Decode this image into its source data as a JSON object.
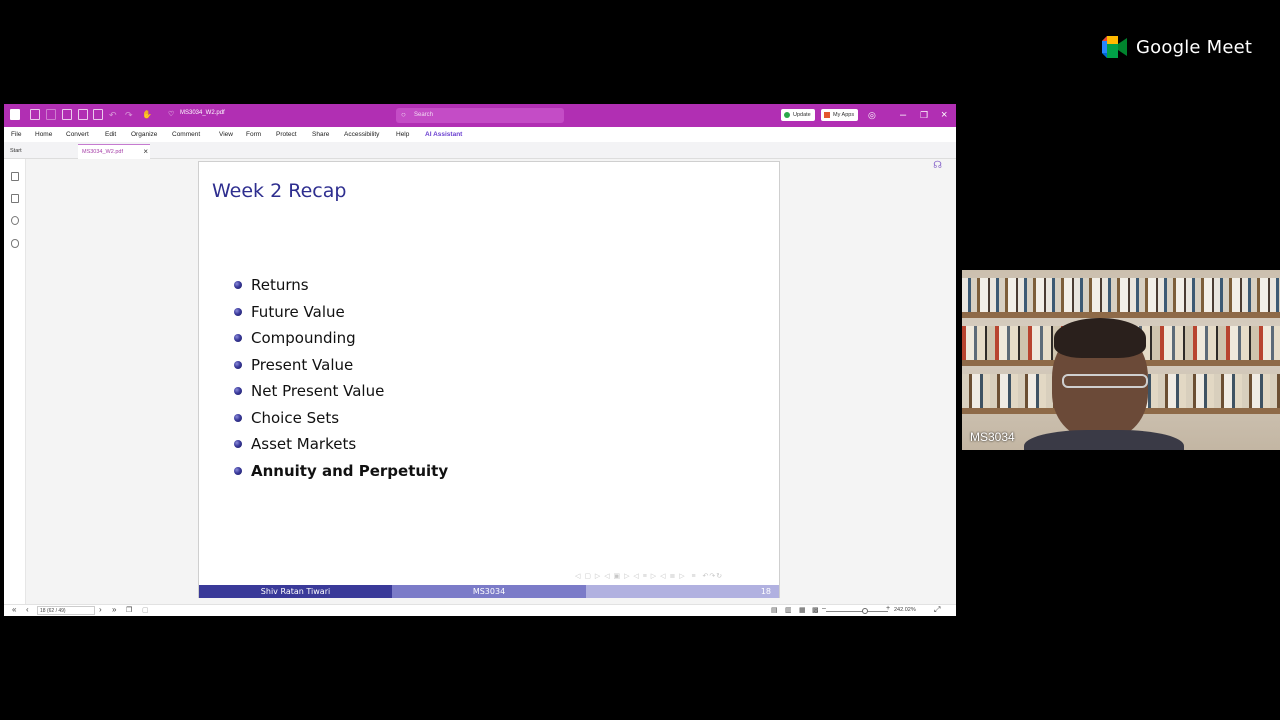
{
  "meet": {
    "brand": "Google Meet",
    "participant_name": "MS3034"
  },
  "app": {
    "file_name": "MS3034_W2.pdf",
    "search_placeholder": "Search",
    "update_label": "Update",
    "apps_label": "My Apps",
    "menu": [
      "File",
      "Home",
      "Convert",
      "Edit",
      "Organize",
      "Comment",
      "View",
      "Form",
      "Protect",
      "Share",
      "Accessibility",
      "Help",
      "AI Assistant"
    ],
    "tabs": {
      "start": "Start",
      "doc": "MS3034_W2.pdf"
    },
    "page_indicator": "18 (62 / 49)",
    "zoom": "242.02%",
    "accent": "#b12fb3"
  },
  "slide": {
    "title": "Week 2 Recap",
    "bullets": [
      "Returns",
      "Future Value",
      "Compounding",
      "Present Value",
      "Net Present Value",
      "Choice Sets",
      "Asset Markets",
      "Annuity and Perpetuity"
    ],
    "highlighted_bullet": "Annuity and Perpetuity",
    "footer": {
      "author": "Shiv Ratan Tiwari",
      "course": "MS3034",
      "page": "18"
    },
    "colors": {
      "title": "#2e2e8f",
      "footer_dark": "#3a3a99",
      "footer_mid": "#7b7bc8",
      "footer_light": "#b1b1e0"
    }
  }
}
